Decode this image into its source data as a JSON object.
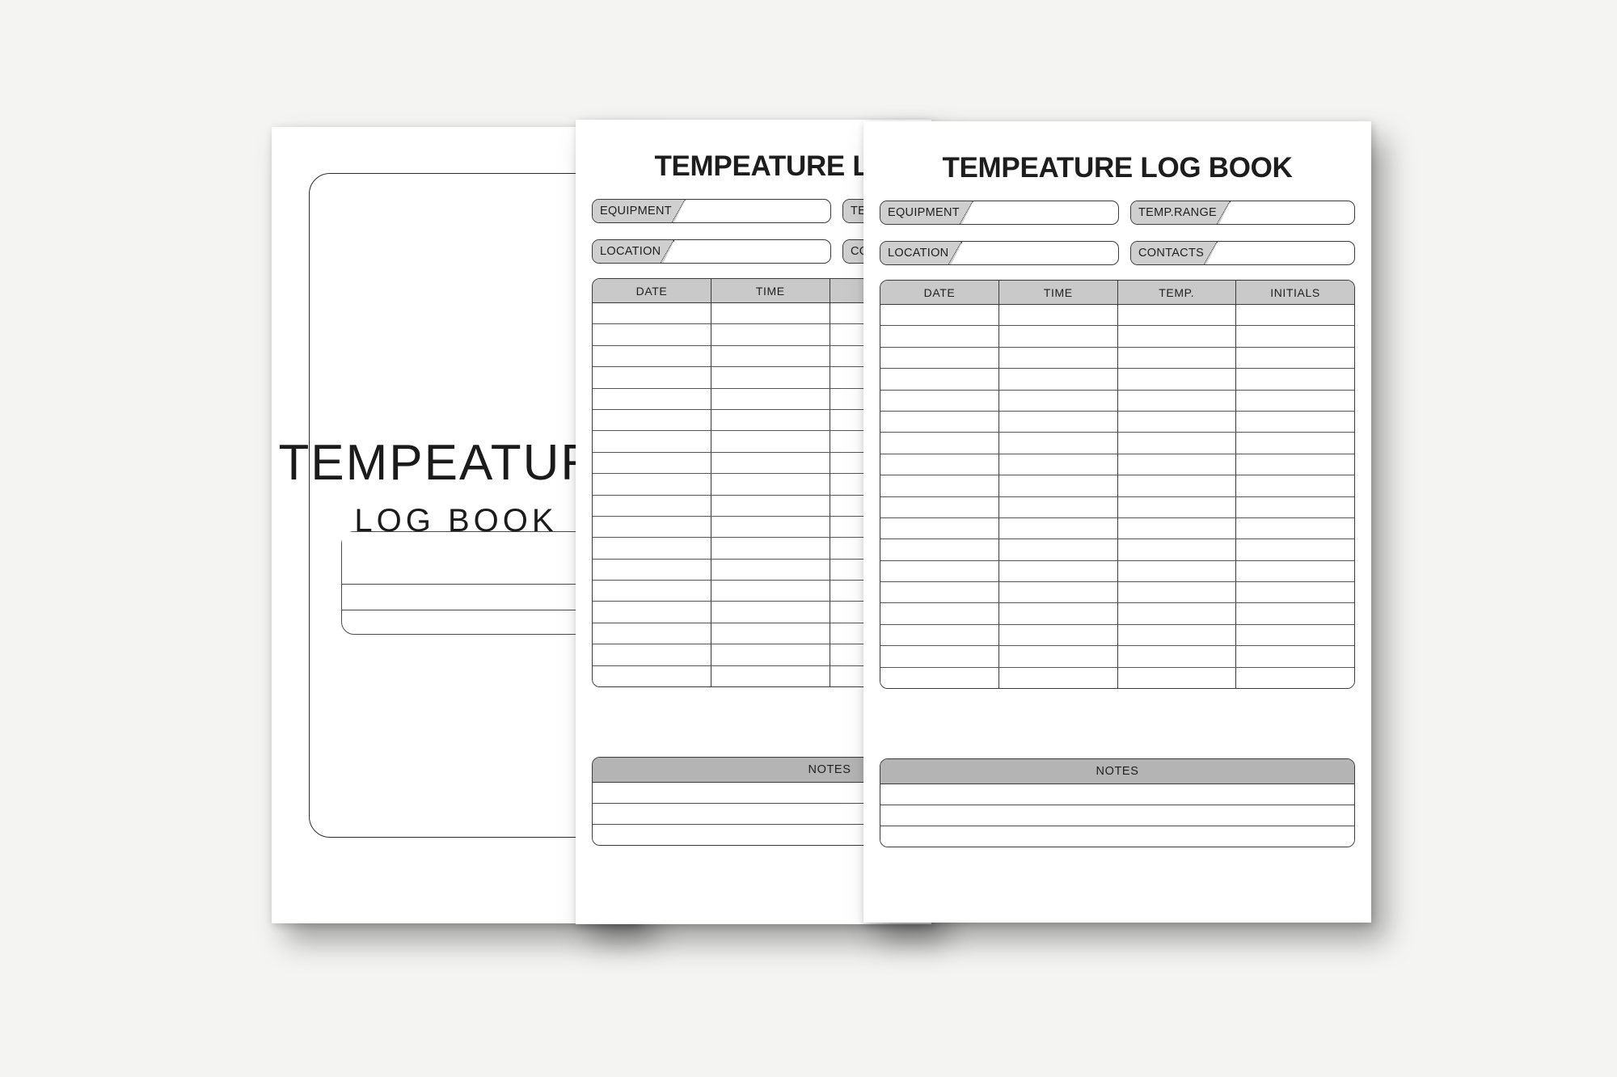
{
  "background_color": "#f4f4f3",
  "cover": {
    "title": "TEMPEATURE",
    "subtitle": "LOG BOOK",
    "line_count": 3
  },
  "log_page": {
    "title": "TEMPEATURE LOG BOOK",
    "fields": [
      {
        "label": "EQUIPMENT",
        "value": ""
      },
      {
        "label": "TEMP.RANGE",
        "value": ""
      },
      {
        "label": "LOCATION",
        "value": ""
      },
      {
        "label": "CONTACTS",
        "value": ""
      }
    ],
    "table": {
      "columns": [
        "DATE",
        "TIME",
        "TEMP.",
        "INITIALS"
      ],
      "row_count": 18,
      "rows": [
        [
          "",
          "",
          "",
          ""
        ],
        [
          "",
          "",
          "",
          ""
        ],
        [
          "",
          "",
          "",
          ""
        ],
        [
          "",
          "",
          "",
          ""
        ],
        [
          "",
          "",
          "",
          ""
        ],
        [
          "",
          "",
          "",
          ""
        ],
        [
          "",
          "",
          "",
          ""
        ],
        [
          "",
          "",
          "",
          ""
        ],
        [
          "",
          "",
          "",
          ""
        ],
        [
          "",
          "",
          "",
          ""
        ],
        [
          "",
          "",
          "",
          ""
        ],
        [
          "",
          "",
          "",
          ""
        ],
        [
          "",
          "",
          "",
          ""
        ],
        [
          "",
          "",
          "",
          ""
        ],
        [
          "",
          "",
          "",
          ""
        ],
        [
          "",
          "",
          "",
          ""
        ],
        [
          "",
          "",
          "",
          ""
        ],
        [
          "",
          "",
          "",
          ""
        ]
      ]
    },
    "notes": {
      "header": "NOTES",
      "line_count": 3,
      "lines": [
        "",
        "",
        ""
      ]
    }
  },
  "colors": {
    "chip_fill": "#cfcfcf",
    "table_header_fill": "#c9c9c9",
    "notes_header_fill": "#b4b4b4",
    "ink": "#1d1d1d",
    "rule": "#3a3a3a"
  }
}
